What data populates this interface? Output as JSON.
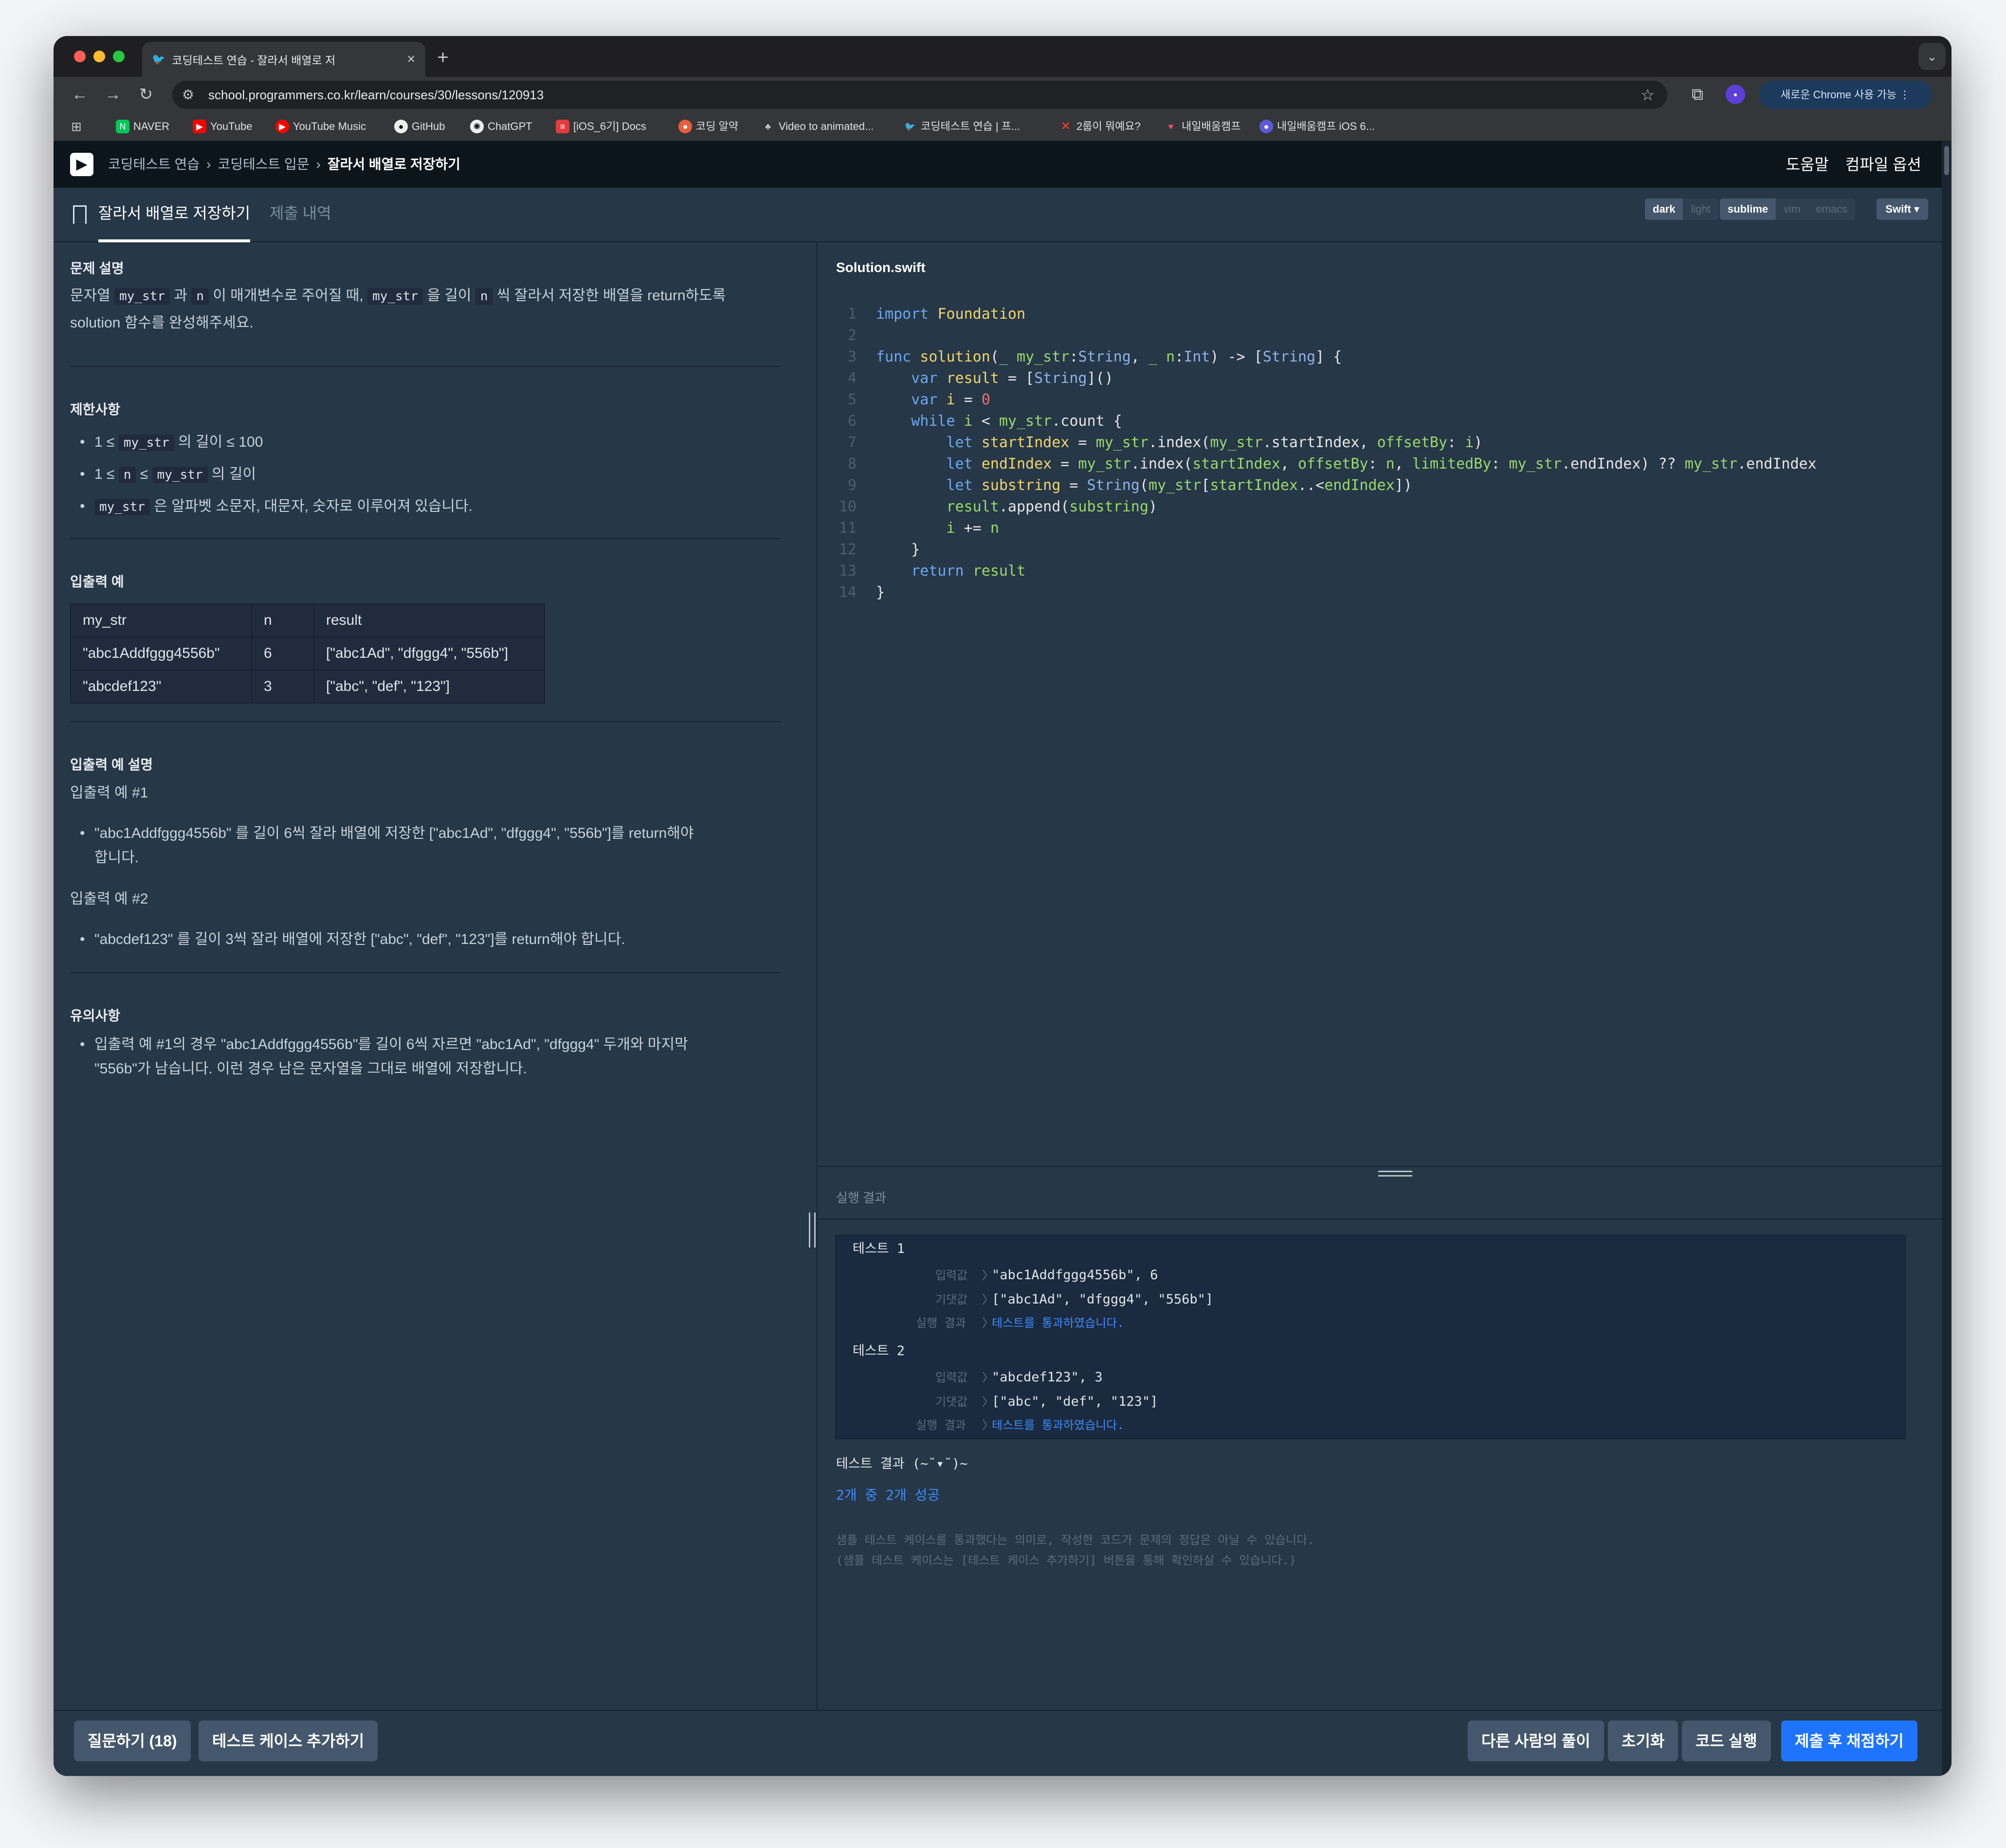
{
  "browser": {
    "tab_title": "코딩테스트 연습 - 잘라서 배열로 저",
    "url": "school.programmers.co.kr/learn/courses/30/lessons/120913",
    "chrome_update_label": "새로운 Chrome 사용 가능",
    "bookmarks": [
      "NAVER",
      "YouTube",
      "YouTube Music",
      "GitHub",
      "ChatGPT",
      "[iOS_6기] Docs",
      "코딩 알약",
      "Video to animated...",
      "코딩테스트 연습 | 프...",
      "2룹이 뭐예요?",
      "내일배움캠프",
      "내일배움캠프 iOS 6..."
    ]
  },
  "header": {
    "breadcrumb": [
      "코딩테스트 연습",
      "코딩테스트 입문",
      "잘라서 배열로 저장하기"
    ],
    "help_label": "도움말",
    "compile_options_label": "컴파일 옵션"
  },
  "tabs": {
    "active": "잘라서 배열로 저장하기",
    "inactive": "제출 내역"
  },
  "editor_options": {
    "themes": [
      "dark",
      "light"
    ],
    "keymaps": [
      "sublime",
      "vim",
      "emacs"
    ],
    "language": "Swift"
  },
  "problem": {
    "description_title": "문제 설명",
    "description_parts": [
      "문자열",
      "my_str",
      "과",
      "n",
      "이 매개변수로 주어질 때,",
      "my_str",
      "을 길이",
      "n",
      "씩 잘라서 저장한 배열을 return하도록"
    ],
    "description_line2": "solution 함수를 완성해주세요.",
    "constraints_title": "제한사항",
    "constraints": [
      {
        "pre": "1 ≤",
        "code": "my_str",
        "post": "의 길이 ≤ 100"
      },
      {
        "pre": "1 ≤",
        "code": "n",
        "mid": "≤",
        "code2": "my_str",
        "post": "의 길이"
      },
      {
        "pre": "",
        "code": "my_str",
        "post": "은 알파벳 소문자, 대문자, 숫자로 이루어져 있습니다."
      }
    ],
    "io_title": "입출력 예",
    "io_table": {
      "headers": [
        "my_str",
        "n",
        "result"
      ],
      "rows": [
        [
          "\"abc1Addfggg4556b\"",
          "6",
          "[\"abc1Ad\", \"dfggg4\", \"556b\"]"
        ],
        [
          "\"abcdef123\"",
          "3",
          "[\"abc\", \"def\", \"123\"]"
        ]
      ]
    },
    "io_explain_title": "입출력 예 설명",
    "example1_title": "입출력 예 #1",
    "example1_line1": "\"abc1Addfggg4556b\" 를 길이 6씩 잘라 배열에 저장한 [\"abc1Ad\", \"dfggg4\", \"556b\"]를 return해야",
    "example1_line2": "합니다.",
    "example2_title": "입출력 예 #2",
    "example2_line1": "\"abcdef123\" 를 길이 3씩 잘라 배열에 저장한 [\"abc\", \"def\", \"123\"]를 return해야 합니다.",
    "notes_title": "유의사항",
    "notes_line1": "입출력 예 #1의 경우 \"abc1Addfggg4556b\"를 길이 6씩 자르면 \"abc1Ad\", \"dfggg4\" 두개와 마지막",
    "notes_line2": "\"556b\"가 남습니다. 이런 경우 남은 문자열을 그대로 배열에 저장합니다."
  },
  "code": {
    "filename": "Solution.swift",
    "line_numbers": [
      "1",
      "2",
      "3",
      "4",
      "5",
      "6",
      "7",
      "8",
      "9",
      "10",
      "11",
      "12",
      "13",
      "14"
    ]
  },
  "results": {
    "label": "실행 결과",
    "tests": [
      {
        "title": "테스트 1",
        "input_label": "입력값",
        "input": "\"abc1Addfggg4556b\", 6",
        "expected_label": "기댓값",
        "expected": "[\"abc1Ad\", \"dfggg4\", \"556b\"]",
        "result_label": "실행 결과",
        "result": "테스트를 통과하였습니다."
      },
      {
        "title": "테스트 2",
        "input_label": "입력값",
        "input": "\"abcdef123\", 3",
        "expected_label": "기댓값",
        "expected": "[\"abc\", \"def\", \"123\"]",
        "result_label": "실행 결과",
        "result": "테스트를 통과하였습니다."
      }
    ],
    "summary_title": "테스트 결과 (~˘▾˘)~",
    "summary": "2개 중 2개 성공",
    "note1": "샘플 테스트 케이스를 통과했다는 의미로, 작성한 코드가 문제의 정답은 아닐 수 있습니다.",
    "note2": "(샘플 테스트 케이스는 [테스트 케이스 추가하기] 버튼을 통해 확인하실 수 있습니다.)"
  },
  "bottom": {
    "ask_label": "질문하기 (18)",
    "add_testcase_label": "테스트 케이스 추가하기",
    "others_label": "다른 사람의 풀이",
    "reset_label": "초기화",
    "run_label": "코드 실행",
    "submit_label": "제출 후 채점하기"
  },
  "colors": {
    "background": "#263747",
    "header": "#0c151c",
    "accent": "#1e74ff",
    "pass": "#3d8cff"
  }
}
